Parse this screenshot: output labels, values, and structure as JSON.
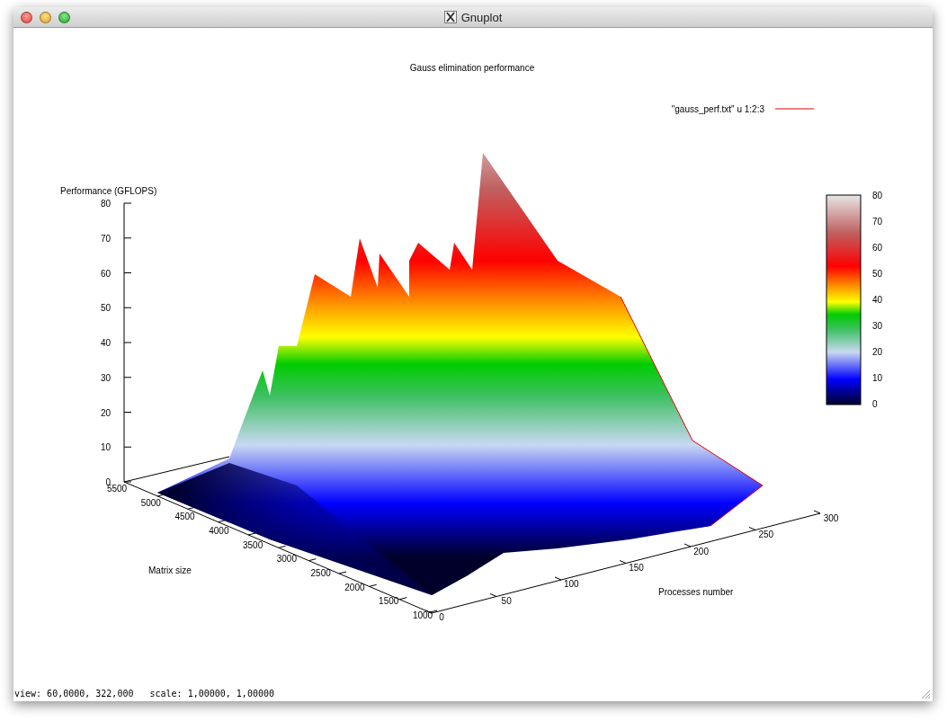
{
  "window": {
    "title": "Gnuplot"
  },
  "plot": {
    "title": "Gauss elimination performance",
    "legend": {
      "label": "\"gauss_perf.txt\" u 1:2:3"
    },
    "z_axis": {
      "label": "Performance (GFLOPS)",
      "ticks": [
        "80",
        "70",
        "60",
        "50",
        "40",
        "30",
        "20",
        "10",
        "0"
      ]
    },
    "x_axis": {
      "label": "Matrix size",
      "ticks": [
        "5500",
        "5000",
        "4500",
        "4000",
        "3500",
        "3000",
        "2500",
        "2000",
        "1500",
        "1000"
      ]
    },
    "y_axis": {
      "label": "Processes number",
      "ticks": [
        "0",
        "50",
        "100",
        "150",
        "200",
        "250",
        "300"
      ]
    },
    "colorbar": {
      "ticks": [
        "80",
        "70",
        "60",
        "50",
        "40",
        "30",
        "20",
        "10",
        "0"
      ]
    }
  },
  "status_bar": {
    "text": "view: 60,0000, 322,000   scale: 1,00000, 1,00000"
  }
}
